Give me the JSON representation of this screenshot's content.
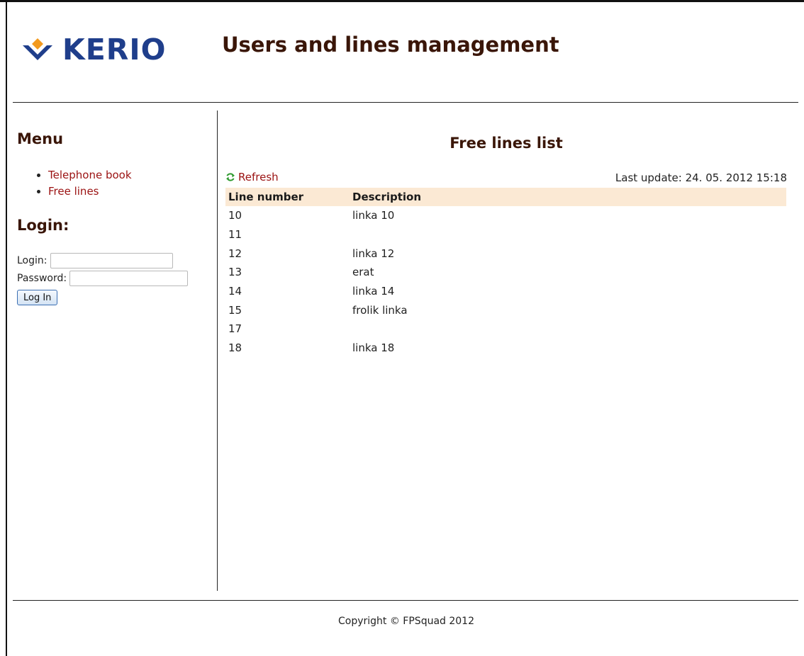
{
  "header": {
    "logo_text": "KERIO",
    "title": "Users and lines management",
    "logo_colors": {
      "diamond": "#f39a1e",
      "chevron": "#1f3e8b"
    }
  },
  "sidebar": {
    "menu_title": "Menu",
    "menu_items": [
      {
        "label": "Telephone book"
      },
      {
        "label": "Free lines"
      }
    ],
    "login_title": "Login:",
    "login_label": "Login:",
    "login_value": "",
    "password_label": "Password:",
    "password_value": "",
    "login_button": "Log In"
  },
  "main": {
    "title": "Free lines list",
    "refresh_label": "Refresh",
    "refresh_icon": "refresh-icon",
    "last_update": "Last update: 24. 05. 2012 15:18",
    "table": {
      "columns": [
        "Line number",
        "Description"
      ],
      "rows": [
        {
          "number": "10",
          "description": "linka 10"
        },
        {
          "number": "11",
          "description": ""
        },
        {
          "number": "12",
          "description": "linka 12"
        },
        {
          "number": "13",
          "description": "erat"
        },
        {
          "number": "14",
          "description": "linka 14"
        },
        {
          "number": "15",
          "description": "frolik linka"
        },
        {
          "number": "17",
          "description": ""
        },
        {
          "number": "18",
          "description": "linka 18"
        }
      ]
    }
  },
  "footer": {
    "copyright": "Copyright © FPSquad 2012"
  },
  "colors": {
    "link": "#9b1212",
    "heading": "#3a1608",
    "table_header_bg": "#fbe9d4"
  }
}
